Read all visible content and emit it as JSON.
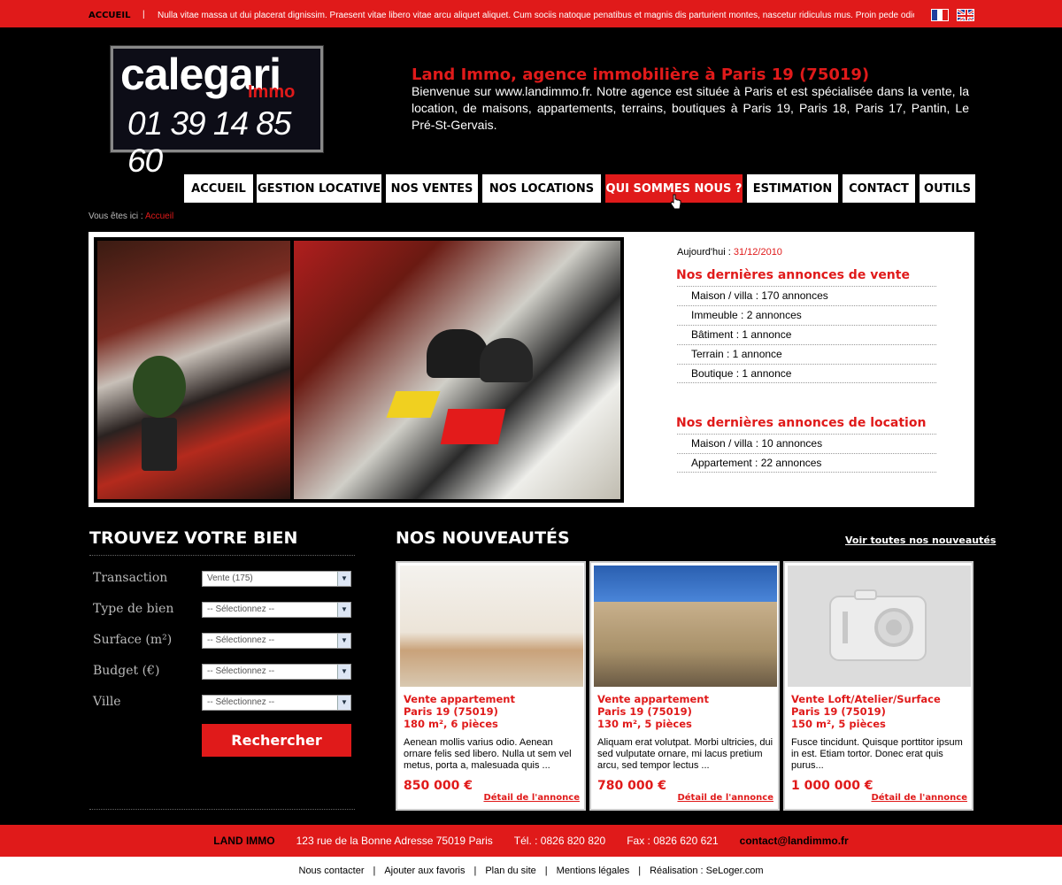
{
  "topbar": {
    "home": "ACCUEIL",
    "separator": "|",
    "ticker": "Nulla vitae massa ut dui placerat dignissim. Praesent vitae libero vitae arcu aliquet aliquet. Cum sociis natoque penatibus et magnis dis parturient montes, nascetur ridiculus mus. Proin pede odio,"
  },
  "logo": {
    "brand": "calegari",
    "sub": "Immo",
    "phone": "01 39 14 85 60"
  },
  "intro": {
    "title": "Land Immo, agence immobilière à Paris 19 (75019)",
    "text": "Bienvenue sur www.landimmo.fr. Notre agence est située à Paris et est spécialisée dans la vente, la location, de maisons, appartements, terrains, boutiques à Paris 19, Paris 18, Paris 17, Pantin, Le Pré-St-Gervais."
  },
  "nav": [
    "ACCUEIL",
    "GESTION LOCATIVE",
    "NOS VENTES",
    "NOS LOCATIONS",
    "QUI SOMMES NOUS ?",
    "ESTIMATION",
    "CONTACT",
    "OUTILS"
  ],
  "breadcrumb": {
    "prefix": "Vous êtes ici :",
    "current": "Accueil"
  },
  "today": {
    "label": "Aujourd'hui :",
    "date": "31/12/2010"
  },
  "sale": {
    "title": "Nos dernières annonces de vente",
    "items": [
      "Maison / villa : 170 annonces",
      "Immeuble : 2 annonces",
      "Bâtiment : 1 annonce",
      "Terrain : 1 annonce",
      "Boutique : 1 annonce"
    ]
  },
  "rent": {
    "title": "Nos dernières annonces de location",
    "items": [
      "Maison / villa : 10 annonces",
      "Appartement : 22 annonces"
    ]
  },
  "search": {
    "title": "TROUVEZ VOTRE BIEN",
    "fields": [
      {
        "label": "Transaction",
        "value": "Vente (175)"
      },
      {
        "label": "Type de bien",
        "value": "-- Sélectionnez --"
      },
      {
        "label": "Surface (m²)",
        "value": "-- Sélectionnez --"
      },
      {
        "label": "Budget (€)",
        "value": "-- Sélectionnez --"
      },
      {
        "label": "Ville",
        "value": "-- Sélectionnez --"
      }
    ],
    "button": "Rechercher"
  },
  "news": {
    "title": "NOS NOUVEAUTÉS",
    "see_all": "Voir toutes nos nouveautés",
    "cards": [
      {
        "type": "Vente appartement",
        "city": "Paris 19 (75019)",
        "size": "180 m², 6 pièces",
        "desc": "Aenean mollis varius odio. Aenean ornare felis sed libero. Nulla ut sem vel metus, porta a, malesuada quis ...",
        "price": "850 000 €",
        "detail": "Détail de l'annonce"
      },
      {
        "type": "Vente appartement",
        "city": "Paris 19 (75019)",
        "size": "130 m², 5 pièces",
        "desc": "Aliquam erat volutpat. Morbi ultricies, dui sed vulputate ornare, mi lacus pretium arcu, sed tempor lectus ...",
        "price": "780 000 €",
        "detail": "Détail de l'annonce"
      },
      {
        "type": "Vente Loft/Atelier/Surface",
        "city": "Paris 19 (75019)",
        "size": "150 m², 5 pièces",
        "desc": "Fusce tincidunt. Quisque porttitor ipsum in est. Etiam tortor. Donec erat quis purus...",
        "price": "1 000 000 €",
        "detail": "Détail de l'annonce"
      }
    ]
  },
  "footer": {
    "company": "LAND IMMO",
    "address": "123 rue de la Bonne Adresse 75019 Paris",
    "phone": "Tél. : 0826 820 820",
    "fax": "Fax : 0826 620 621",
    "email": "contact@landimmo.fr"
  },
  "bottom_links": [
    "Nous contacter",
    "Ajouter aux favoris",
    "Plan du site",
    "Mentions légales",
    "Réalisation : SeLoger.com"
  ],
  "colors": {
    "accent": "#e01a1a",
    "background": "#000000"
  }
}
